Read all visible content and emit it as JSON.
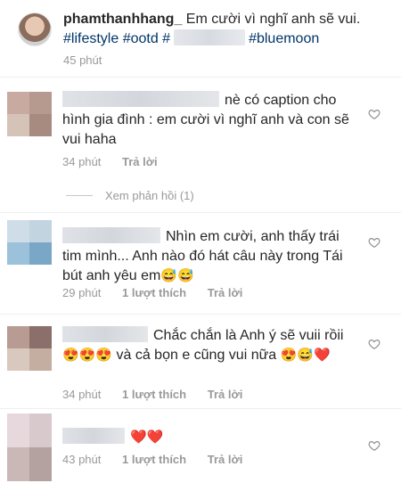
{
  "caption": {
    "username": "phamthanhhang_",
    "text": "Em cười vì nghĩ anh sẽ vui.",
    "hashtags_before": "#lifestyle #ootd #",
    "hashtags_after": "#bluemoon",
    "time": "45 phút"
  },
  "comments": [
    {
      "text_line1": "nè có caption",
      "text_rest": "cho hình gia đình : em cười vì nghĩ anh và con sẽ vui haha",
      "time": "34 phút",
      "reply_label": "Trả lời"
    },
    {
      "text": "Nhìn em cười, anh thấy trái tim mình... Anh nào đó hát câu này trong Tái bút anh yêu em",
      "emoji": "😅😅",
      "time": "29 phút",
      "likes": "1 lượt thích",
      "reply_label": "Trả lời"
    },
    {
      "text_a": "Chắc chắn là Anh ý sẽ vuii rồii",
      "emoji_a": "😍😍😍",
      "text_b": "và cả bọn e cũng vui nữa",
      "emoji_b": "😍😅❤️",
      "time": "34 phút",
      "likes": "1 lượt thích",
      "reply_label": "Trả lời"
    },
    {
      "emoji": "❤️❤️",
      "time": "43 phút",
      "likes": "1 lượt thích",
      "reply_label": "Trả lời"
    }
  ],
  "view_replies": "Xem phản hồi (1)",
  "icons": {
    "like": "heart-outline-icon"
  },
  "colors": {
    "hashtag": "#003569",
    "meta": "#999999",
    "heart_red": "#ed4956"
  }
}
